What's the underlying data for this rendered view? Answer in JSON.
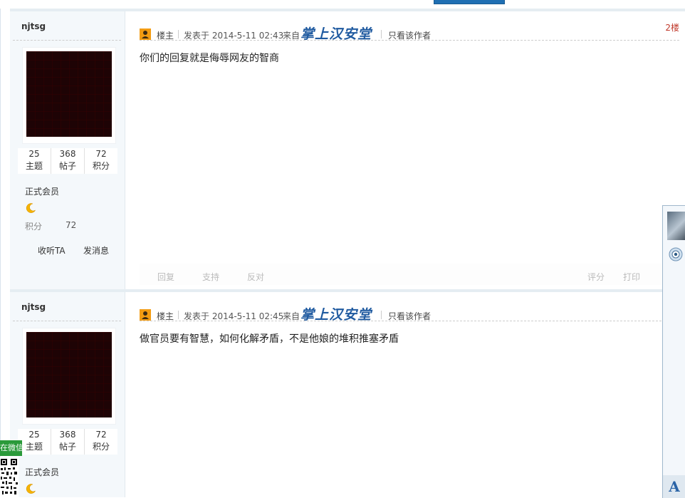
{
  "posts": [
    {
      "username": "njtsg",
      "stats": [
        {
          "value": "25",
          "label": "主题"
        },
        {
          "value": "368",
          "label": "帖子"
        },
        {
          "value": "72",
          "label": "积分"
        }
      ],
      "group": "正式会员",
      "credit_label": "积分",
      "credit_value": "72",
      "follow_label": "收听TA",
      "message_label": "发消息",
      "louzhu_label": "楼主",
      "post_time": "发表于 2014-5-11 02:43",
      "source_label": "来自",
      "source_logo": "掌上汉安堂",
      "author_only": "只看该作者",
      "floor": "2楼",
      "message": "你们的回复就是侮辱网友的智商",
      "actions": {
        "reply": "回复",
        "support": "支持",
        "oppose": "反对",
        "rate": "评分",
        "print": "打印"
      }
    },
    {
      "username": "njtsg",
      "stats": [
        {
          "value": "25",
          "label": "主题"
        },
        {
          "value": "368",
          "label": "帖子"
        },
        {
          "value": "72",
          "label": "积分"
        }
      ],
      "group": "正式会员",
      "louzhu_label": "楼主",
      "post_time": "发表于 2014-5-11 02:45",
      "source_label": "来自",
      "source_logo": "掌上汉安堂",
      "author_only": "只看该作者",
      "message": "做官员要有智慧，如何化解矛盾，不是他娘的堆积推塞矛盾"
    }
  ],
  "wechat_tab": "在微信",
  "font_button": "A",
  "icons": {
    "louzhu": "poster-user-icon",
    "moon": "moon-level-icon",
    "camera": "webcam-icon"
  },
  "colors": {
    "floor": "#c0392b",
    "logo": "#1f5aa0",
    "sidebar_bg": "#f4f8fb"
  }
}
